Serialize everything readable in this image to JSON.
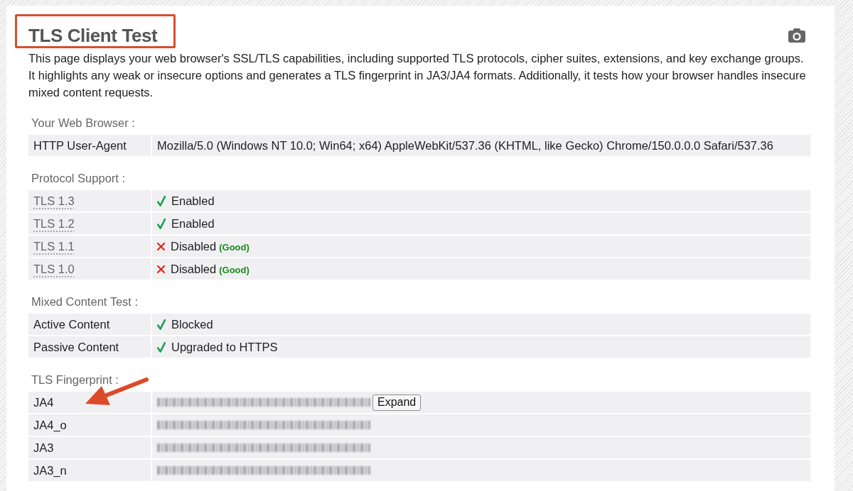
{
  "title": {
    "text": "TLS Client Test",
    "highlighted": true
  },
  "description": "This page displays your web browser's SSL/TLS capabilities, including supported TLS protocols, cipher suites, extensions, and key exchange groups. It highlights any weak or insecure options and generates a TLS fingerprint in JA3/JA4 formats. Additionally, it tests how your browser handles insecure mixed content requests.",
  "sections": [
    {
      "heading": "Your Web Browser :",
      "rows": [
        {
          "kind": "text",
          "label": "HTTP User-Agent",
          "value": "Mozilla/5.0 (Windows NT 10.0; Win64; x64) AppleWebKit/537.36 (KHTML, like Gecko) Chrome/150.0.0.0 Safari/537.36"
        }
      ]
    },
    {
      "heading": "Protocol Support :",
      "rows": [
        {
          "kind": "protocol",
          "label": "TLS 1.3",
          "passed": true,
          "value": "Enabled"
        },
        {
          "kind": "protocol",
          "label": "TLS 1.2",
          "passed": true,
          "value": "Enabled"
        },
        {
          "kind": "protocol",
          "label": "TLS 1.1",
          "passed": false,
          "value": "Disabled",
          "note": "(Good)"
        },
        {
          "kind": "protocol",
          "label": "TLS 1.0",
          "passed": false,
          "value": "Disabled",
          "note": "(Good)"
        }
      ]
    },
    {
      "heading": "Mixed Content Test :",
      "rows": [
        {
          "kind": "status",
          "label": "Active Content",
          "passed": true,
          "value": "Blocked"
        },
        {
          "kind": "status",
          "label": "Passive Content",
          "passed": true,
          "value": "Upgraded to HTTPS"
        }
      ]
    },
    {
      "heading": "TLS Fingerprint :",
      "rows": [
        {
          "kind": "fingerprint",
          "label": "JA4",
          "button": "Expand",
          "arrow": true
        },
        {
          "kind": "fingerprint",
          "label": "JA4_o",
          "arrow": false
        },
        {
          "kind": "fingerprint",
          "label": "JA3",
          "arrow": false
        },
        {
          "kind": "fingerprint",
          "label": "JA3_n",
          "arrow": false
        }
      ]
    }
  ]
}
